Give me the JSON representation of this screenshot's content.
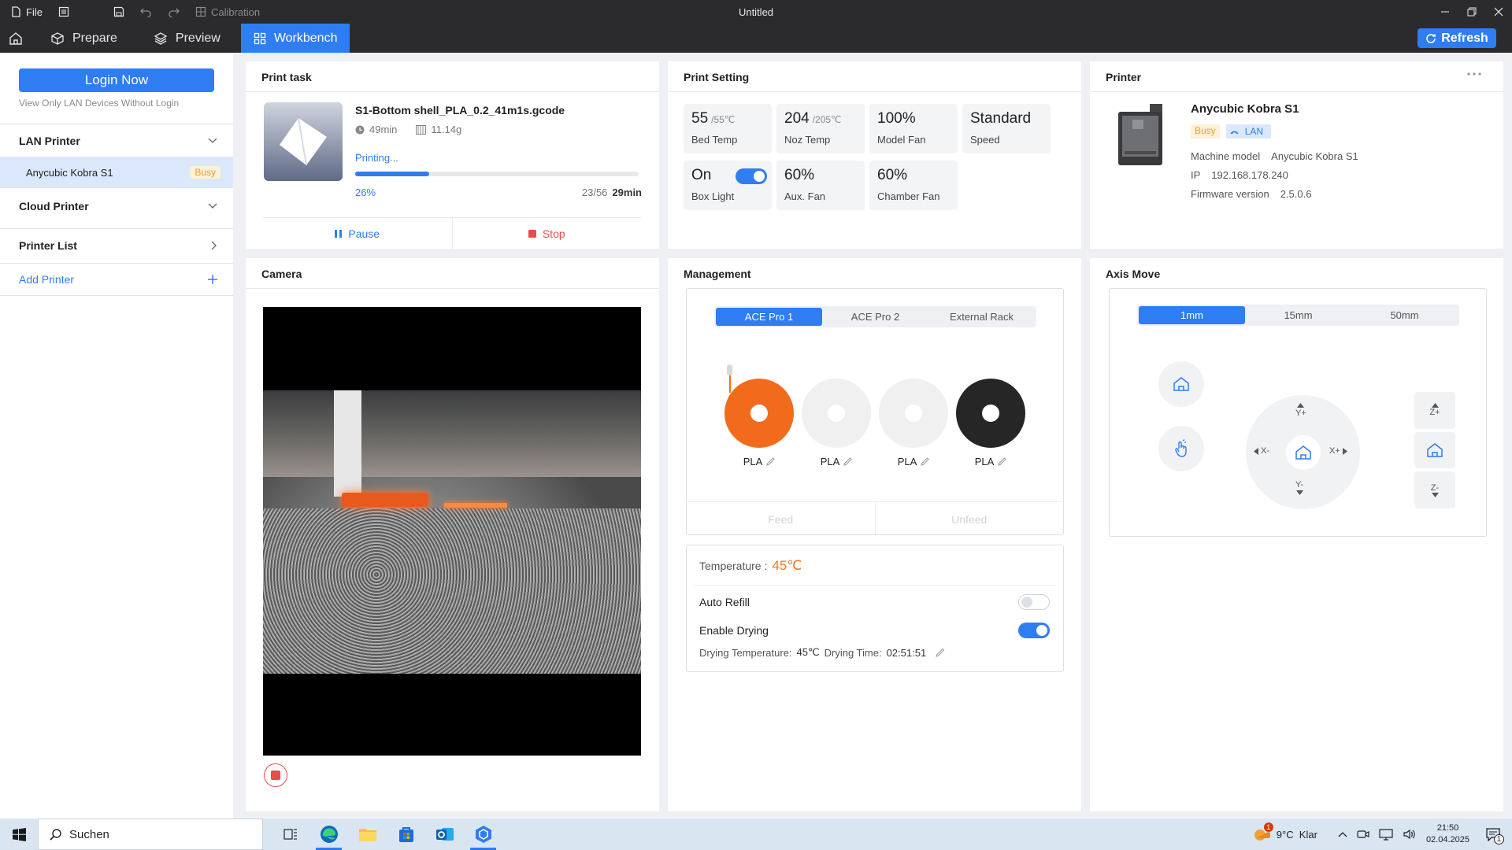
{
  "titlebar": {
    "file_label": "File",
    "calibration_label": "Calibration",
    "window_title": "Untitled"
  },
  "nav": {
    "tabs": [
      {
        "label": "Prepare",
        "icon": "cube-icon"
      },
      {
        "label": "Preview",
        "icon": "layers-icon"
      },
      {
        "label": "Workbench",
        "icon": "grid-icon"
      }
    ],
    "refresh_label": "Refresh"
  },
  "sidebar": {
    "login_label": "Login Now",
    "login_hint": "View Only LAN Devices Without Login",
    "lan_printer": "LAN Printer",
    "device_name": "Anycubic Kobra S1",
    "device_status": "Busy",
    "cloud_printer": "Cloud Printer",
    "printer_list": "Printer List",
    "add_printer": "Add Printer"
  },
  "print_task": {
    "title": "Print task",
    "filename": "S1-Bottom shell_PLA_0.2_41m1s.gcode",
    "duration": "49min",
    "weight": "11.14g",
    "status": "Printing...",
    "progress": 0.26,
    "progress_label": "26%",
    "layers": "23/56",
    "remaining": "29min",
    "pause_label": "Pause",
    "stop_label": "Stop"
  },
  "print_setting": {
    "title": "Print Setting",
    "tiles": [
      {
        "value": "55",
        "target": "/55℃",
        "label": "Bed Temp"
      },
      {
        "value": "204",
        "target": "/205℃",
        "label": "Noz Temp"
      },
      {
        "value": "100%",
        "target": "",
        "label": "Model Fan"
      },
      {
        "value": "Standard",
        "target": "",
        "label": "Speed"
      },
      {
        "value": "On",
        "target": "",
        "label": "Box Light"
      },
      {
        "value": "60%",
        "target": "",
        "label": "Aux. Fan"
      },
      {
        "value": "60%",
        "target": "",
        "label": "Chamber Fan"
      }
    ],
    "box_light_on": true
  },
  "printer": {
    "title": "Printer",
    "name": "Anycubic Kobra S1",
    "badge_busy": "Busy",
    "badge_lan": "LAN",
    "model_key": "Machine model",
    "model_val": "Anycubic Kobra S1",
    "ip_key": "IP",
    "ip_val": "192.168.178.240",
    "fw_key": "Firmware version",
    "fw_val": "2.5.0.6"
  },
  "camera": {
    "title": "Camera"
  },
  "management": {
    "title": "Management",
    "tabs": [
      "ACE Pro 1",
      "ACE Pro 2",
      "External Rack"
    ],
    "active_tab": 0,
    "spools": [
      {
        "material": "PLA",
        "color": "#f26b1d"
      },
      {
        "material": "PLA",
        "color": "#f0f0f0"
      },
      {
        "material": "PLA",
        "color": "#f0f0f0"
      },
      {
        "material": "PLA",
        "color": "#262626"
      }
    ],
    "feed_label": "Feed",
    "unfeed_label": "Unfeed",
    "temperature_label": "Temperature :",
    "temperature_value": "45℃",
    "auto_refill_label": "Auto Refill",
    "auto_refill_on": false,
    "enable_drying_label": "Enable Drying",
    "enable_drying_on": true,
    "drying_temp_label": "Drying Temperature:",
    "drying_temp_value": "45℃",
    "drying_time_label": "Drying Time:",
    "drying_time_value": "02:51:51"
  },
  "axis_move": {
    "title": "Axis Move",
    "steps": [
      "1mm",
      "15mm",
      "50mm"
    ],
    "active_step": 0,
    "y_plus": "Y+",
    "y_minus": "Y-",
    "x_plus": "X+",
    "x_minus": "X-",
    "z_plus": "Z+",
    "z_minus": "Z-"
  },
  "taskbar": {
    "search_placeholder": "Suchen",
    "weather": "9°C  Klar",
    "weather_badge": "1",
    "time": "21:50",
    "date": "02.04.2025",
    "notification_count": "1"
  }
}
